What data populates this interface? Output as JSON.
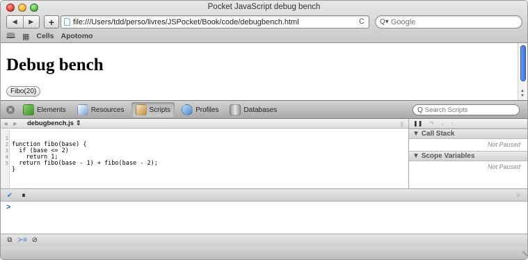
{
  "window": {
    "title": "Pocket JavaScript debug bench"
  },
  "toolbar": {
    "url": "file:///Users/tdd/perso/livres/JSPocket/Book/code/debugbench.html",
    "search_placeholder": "Google"
  },
  "bookmarks": [
    "Cells",
    "Apotomo"
  ],
  "page": {
    "heading": "Debug bench",
    "button_label": "Fibo(20)"
  },
  "inspector": {
    "tabs": [
      {
        "label": "Elements",
        "icon": "elements-icon",
        "active": false
      },
      {
        "label": "Resources",
        "icon": "resources-icon",
        "active": false
      },
      {
        "label": "Scripts",
        "icon": "scripts-icon",
        "active": true
      },
      {
        "label": "Profiles",
        "icon": "profiles-icon",
        "active": false
      },
      {
        "label": "Databases",
        "icon": "databases-icon",
        "active": false
      }
    ],
    "search_placeholder": "Search Scripts"
  },
  "scripts": {
    "file": "debugbench.js",
    "code": [
      {
        "n": "1",
        "text": "function fibo(base) {"
      },
      {
        "n": "2",
        "text": "  if (base <= 2)"
      },
      {
        "n": "3",
        "text": "    return 1;"
      },
      {
        "n": "4",
        "text": "  return fibo(base - 1) + fibo(base - 2);"
      },
      {
        "n": "5",
        "text": "}"
      }
    ]
  },
  "sidebar": {
    "call_stack": {
      "title": "Call Stack",
      "status": "Not Paused"
    },
    "scope_variables": {
      "title": "Scope Variables",
      "status": "Not Paused"
    }
  },
  "console": {
    "prompt": ">"
  },
  "colors": {
    "accent": "#3e74d6",
    "prompt": "#1f67c9"
  }
}
